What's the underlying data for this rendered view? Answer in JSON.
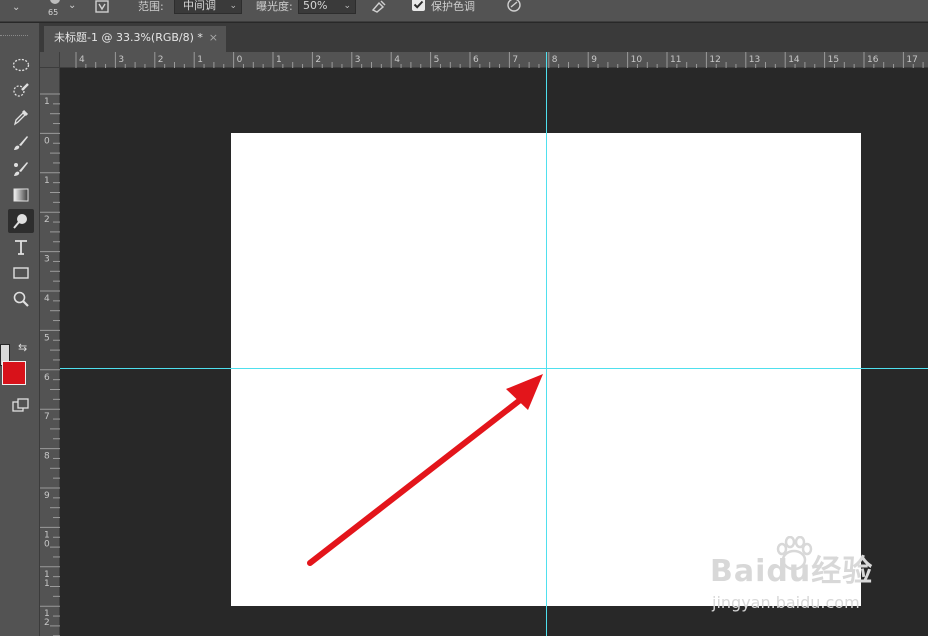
{
  "options_bar": {
    "brush_size": "65",
    "range_label": "范围:",
    "range_value": "中间调",
    "exposure_label": "曝光度:",
    "exposure_value": "50%",
    "protect_tones_label": "保护色调",
    "protect_tones_checked": true
  },
  "document_tab": {
    "title": "未标题-1 @ 33.3%(RGB/8) *",
    "close": "×"
  },
  "rulers": {
    "top_labels": [
      "4",
      "3",
      "2",
      "1",
      "0",
      "1",
      "2",
      "3",
      "4",
      "5",
      "6",
      "7",
      "8",
      "9",
      "10",
      "11",
      "12",
      "13",
      "14",
      "15",
      "16",
      "17"
    ],
    "left_labels": [
      "1",
      "0",
      "1",
      "2",
      "3",
      "4",
      "5",
      "6",
      "7",
      "8",
      "9",
      "1\n0",
      "1\n1",
      "1\n2"
    ]
  },
  "tools": [
    "elliptical-marquee",
    "quick-selection",
    "eyedropper",
    "brush",
    "mixer-brush",
    "gradient",
    "dodge",
    "type",
    "rectangle",
    "zoom"
  ],
  "colors": {
    "foreground": "#d9d9d9",
    "background": "#d8121a",
    "guide": "#4fe0ee",
    "arrow": "#e3151b"
  },
  "watermark": {
    "logo": "Baidu经验",
    "url": "jingyan.baidu.com"
  }
}
